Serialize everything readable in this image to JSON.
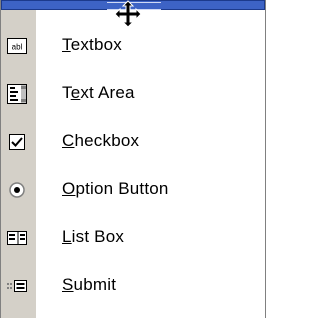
{
  "menu": {
    "items": [
      {
        "label_before": "",
        "accel": "T",
        "label_after": "extbox",
        "icon": "textbox-icon"
      },
      {
        "label_before": "T",
        "accel": "e",
        "label_after": "xt Area",
        "icon": "text-area-icon"
      },
      {
        "label_before": "",
        "accel": "C",
        "label_after": "heckbox",
        "icon": "checkbox-icon"
      },
      {
        "label_before": "",
        "accel": "O",
        "label_after": "ption Button",
        "icon": "option-button-icon"
      },
      {
        "label_before": "",
        "accel": "L",
        "label_after": "ist Box",
        "icon": "list-box-icon"
      },
      {
        "label_before": "",
        "accel": "S",
        "label_after": "ubmit",
        "icon": "submit-icon"
      }
    ],
    "textbox_icon_text": "abl",
    "colors": {
      "title_bar": "#3d63c5",
      "icon_column": "#d4d0c8"
    }
  }
}
